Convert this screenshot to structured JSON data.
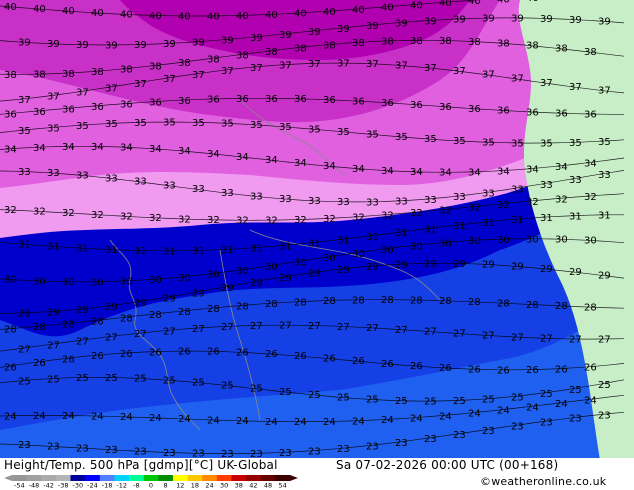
{
  "header": {
    "title": "Height/Temp. 500 hPa [gdmp][°C] UK-Global",
    "time": "Sa 07-02-2026 00:00 UTC (00+168)",
    "credit": "©weatheronline.co.uk"
  },
  "legend": {
    "tick_labels": [
      "-54",
      "-48",
      "-42",
      "-38",
      "-30",
      "-24",
      "-18",
      "-12",
      "-8",
      "0",
      "8",
      "12",
      "18",
      "24",
      "30",
      "38",
      "42",
      "48",
      "54"
    ],
    "colors": [
      "#969696",
      "#a0a0a0",
      "#aaaaaa",
      "#b4b4b4",
      "#0000a0",
      "#0000ff",
      "#5080ff",
      "#00d2ff",
      "#00ff96",
      "#00c800",
      "#008c00",
      "#ffff00",
      "#ffc800",
      "#ff8c00",
      "#ff3c00",
      "#c80000",
      "#960000",
      "#640000",
      "#3c0000"
    ]
  },
  "map_colors": {
    "band_m23": "#2060f0",
    "band_m26": "#1540e6",
    "band_m29": "#0000cd",
    "band_m31": "#f09af0",
    "band_m34": "#e060e0",
    "band_m37": "#c830c8",
    "band_m39": "#b000b0",
    "land": "#c8eec8",
    "contour": "#000000"
  },
  "contour_labels": {
    "rows": [
      {
        "v": -40,
        "text": "40"
      },
      {
        "v": -39,
        "text": "39"
      },
      {
        "v": -38,
        "text": "38"
      },
      {
        "v": -37,
        "text": "37"
      },
      {
        "v": -36,
        "text": "36"
      },
      {
        "v": -35,
        "text": "35"
      },
      {
        "v": -34,
        "text": "34"
      },
      {
        "v": -33,
        "text": "33"
      },
      {
        "v": -32,
        "text": "32"
      },
      {
        "v": -31,
        "text": "31"
      },
      {
        "v": -30,
        "text": "30"
      },
      {
        "v": -29,
        "text": "29"
      },
      {
        "v": -28,
        "text": "28"
      },
      {
        "v": -27,
        "text": "27"
      },
      {
        "v": -26,
        "text": "26"
      },
      {
        "v": -25,
        "text": "25"
      },
      {
        "v": -24,
        "text": "24"
      },
      {
        "v": -23,
        "text": "23"
      }
    ]
  }
}
